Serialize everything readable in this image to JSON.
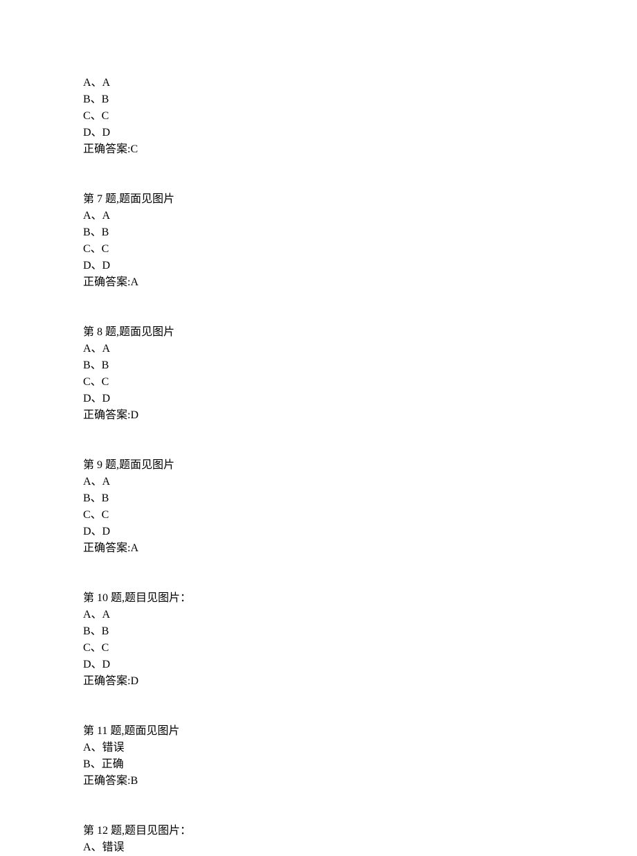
{
  "questions": [
    {
      "header": "",
      "options": [
        "A、A",
        "B、B",
        "C、C",
        "D、D"
      ],
      "answer": "正确答案:C"
    },
    {
      "header": "第 7 题,题面见图片",
      "options": [
        "A、A",
        "B、B",
        "C、C",
        "D、D"
      ],
      "answer": "正确答案:A"
    },
    {
      "header": "第 8 题,题面见图片",
      "options": [
        "A、A",
        "B、B",
        "C、C",
        "D、D"
      ],
      "answer": "正确答案:D"
    },
    {
      "header": "第 9 题,题面见图片",
      "options": [
        "A、A",
        "B、B",
        "C、C",
        "D、D"
      ],
      "answer": "正确答案:A"
    },
    {
      "header": "第 10 题,题目见图片：",
      "options": [
        "A、A",
        "B、B",
        "C、C",
        "D、D"
      ],
      "answer": "正确答案:D"
    },
    {
      "header": "第 11 题,题面见图片",
      "options": [
        "A、错误",
        "B、正确"
      ],
      "answer": "正确答案:B"
    },
    {
      "header": "第 12 题,题目见图片：",
      "options": [
        "A、错误"
      ],
      "answer": ""
    }
  ]
}
